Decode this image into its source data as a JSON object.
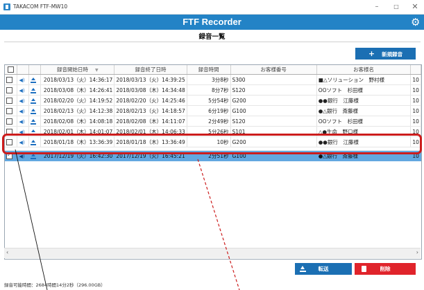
{
  "window": {
    "title": "TAKACOM FTF-MW10",
    "minimize": "–",
    "maximize": "□",
    "close": "✕"
  },
  "header": {
    "title": "FTF Recorder",
    "settings_icon": "gear-icon"
  },
  "page": {
    "subtitle": "録音一覧"
  },
  "toolbar": {
    "new_recording_plus": "+",
    "new_recording_label": "新規録音"
  },
  "table": {
    "columns": [
      "録音開始日時",
      "録音終了日時",
      "録音時間",
      "お客様番号",
      "お客様名"
    ],
    "rows": [
      {
        "start": "2018/03/13（火）14:36:17",
        "end": "2018/03/13（火）14:39:25",
        "duration": "3分8秒",
        "customer_no": "S300",
        "customer_name": "■△ソリューション　野村様",
        "extra": "10",
        "checked": false
      },
      {
        "start": "2018/03/08（木）14:26:41",
        "end": "2018/03/08（木）14:34:48",
        "duration": "8分7秒",
        "customer_no": "S120",
        "customer_name": "OOソフト　杉田様",
        "extra": "10",
        "checked": false
      },
      {
        "start": "2018/02/20（火）14:19:52",
        "end": "2018/02/20（火）14:25:46",
        "duration": "5分54秒",
        "customer_no": "G200",
        "customer_name": "●●銀行　江藤様",
        "extra": "10",
        "checked": false
      },
      {
        "start": "2018/02/13（火）14:12:38",
        "end": "2018/02/13（火）14:18:57",
        "duration": "6分19秒",
        "customer_no": "G100",
        "customer_name": "●△銀行　斎藤様",
        "extra": "10",
        "checked": false
      },
      {
        "start": "2018/02/08（木）14:08:18",
        "end": "2018/02/08（木）14:11:07",
        "duration": "2分49秒",
        "customer_no": "S120",
        "customer_name": "OOソフト　杉田様",
        "extra": "10",
        "checked": false
      },
      {
        "start": "2018/02/01（木）14:01:07",
        "end": "2018/02/01（木）14:06:33",
        "duration": "5分26秒",
        "customer_no": "S101",
        "customer_name": "△●生命　野口様",
        "extra": "10",
        "checked": false
      },
      {
        "start": "2018/01/18（木）13:36:39",
        "end": "2018/01/18（木）13:36:49",
        "duration": "10秒",
        "customer_no": "G200",
        "customer_name": "●●銀行　江藤様",
        "extra": "10",
        "checked": false
      }
    ],
    "selected_row": {
      "start": "2017/12/19（火）16:42:30",
      "end": "2017/12/19（火）16:45:21",
      "duration": "2分51秒",
      "customer_no": "G100",
      "customer_name": "●△銀行　斎藤様",
      "extra": "10",
      "checked": true
    }
  },
  "scrollbar": {
    "left_arrow": "‹",
    "right_arrow": "›"
  },
  "actions": {
    "upload_label": "転送",
    "delete_label": "削除"
  },
  "status": {
    "text": "録音可能時間：2684時間14分2秒（296.00GB）"
  },
  "colors": {
    "accent": "#2383c6",
    "delete": "#e0242b",
    "selection": "#62a8e0",
    "annotation": "#cc1c1c"
  }
}
